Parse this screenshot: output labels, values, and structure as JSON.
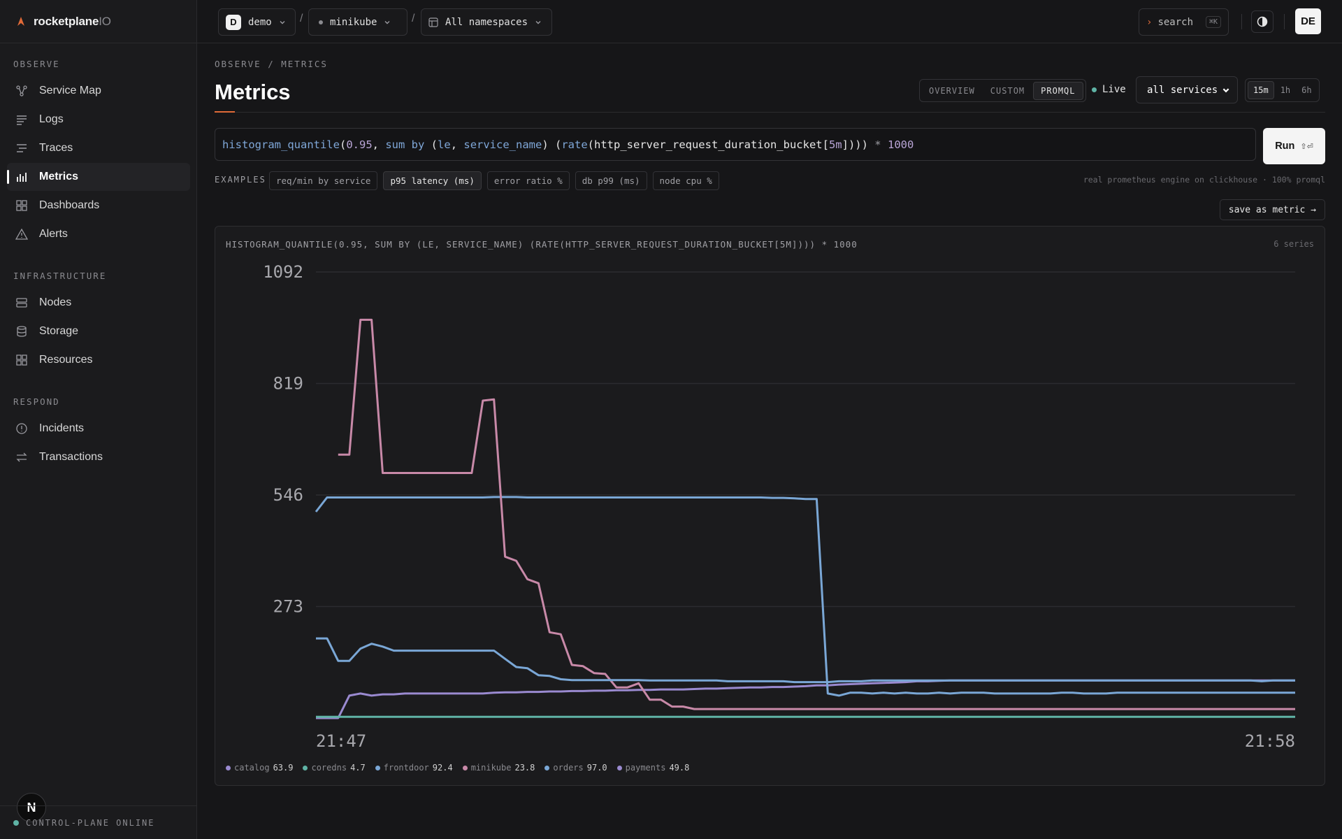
{
  "app": {
    "brand_name": "rocketplane",
    "brand_suffix": "IO",
    "footer_status": "CONTROL-PLANE ONLINE",
    "n_badge": "N"
  },
  "sidebar": {
    "sections": [
      {
        "title": "OBSERVE",
        "items": [
          {
            "label": "Service Map",
            "icon": "service-map-icon"
          },
          {
            "label": "Logs",
            "icon": "logs-icon"
          },
          {
            "label": "Traces",
            "icon": "traces-icon"
          },
          {
            "label": "Metrics",
            "icon": "metrics-icon",
            "active": true
          },
          {
            "label": "Dashboards",
            "icon": "dashboards-icon"
          },
          {
            "label": "Alerts",
            "icon": "alert-triangle-icon"
          }
        ]
      },
      {
        "title": "INFRASTRUCTURE",
        "items": [
          {
            "label": "Nodes",
            "icon": "server-icon"
          },
          {
            "label": "Storage",
            "icon": "database-icon"
          },
          {
            "label": "Resources",
            "icon": "grid-icon"
          }
        ]
      },
      {
        "title": "RESPOND",
        "items": [
          {
            "label": "Incidents",
            "icon": "shield-icon"
          },
          {
            "label": "Transactions",
            "icon": "swap-icon"
          }
        ]
      }
    ]
  },
  "topbar": {
    "org_badge": "D",
    "org": "demo",
    "cluster": "minikube",
    "namespace": "All namespaces",
    "search_label": "search",
    "search_shortcut": "⌘K",
    "avatar": "DE",
    "separator": "/"
  },
  "main": {
    "breadcrumb": "OBSERVE / METRICS",
    "title": "Metrics",
    "mode_tabs": [
      "OVERVIEW",
      "CUSTOM",
      "PROMQL"
    ],
    "active_mode": "PROMQL",
    "live_label": "Live",
    "service_select": "all services",
    "range_tabs": [
      "15m",
      "1h",
      "6h"
    ],
    "active_range": "15m",
    "query": "histogram_quantile(0.95, sum by (le, service_name) (rate(http_server_request_duration_bucket[5m]))) * 1000",
    "run_label": "Run",
    "run_shortcut": "⇧⏎",
    "examples_label": "EXAMPLES",
    "examples": [
      "req/min by service",
      "p95 latency (ms)",
      "error ratio %",
      "db p99 (ms)",
      "node cpu %"
    ],
    "active_example": "p95 latency (ms)",
    "engine_note": "real prometheus engine on clickhouse · 100% promql",
    "save_metric": "save as metric →",
    "panel_title": "HISTOGRAM_QUANTILE(0.95, SUM BY (LE, SERVICE_NAME) (RATE(HTTP_SERVER_REQUEST_DURATION_BUCKET[5M]))) * 1000",
    "series_count": "6 series"
  },
  "chart_data": {
    "type": "line",
    "y_ticks": [
      "1092",
      "819",
      "546",
      "273"
    ],
    "ylim": [
      0,
      1092
    ],
    "x_labels": [
      "21:47",
      "21:58"
    ],
    "grid": true,
    "legend_position": "bottom",
    "series": [
      {
        "name": "catalog",
        "legend_value": "63.9",
        "color": "#9a8ad0",
        "values": [
          0,
          0,
          0,
          55,
          60,
          55,
          58,
          58,
          60,
          60,
          60,
          60,
          60,
          60,
          60,
          60,
          62,
          63,
          63,
          64,
          64,
          65,
          65,
          66,
          66,
          67,
          67,
          68,
          68,
          69,
          69,
          70,
          70,
          70,
          71,
          72,
          72,
          73,
          74,
          75,
          75,
          76,
          76,
          77,
          78,
          80,
          80,
          82,
          83,
          84,
          85,
          86,
          87,
          88,
          90,
          90,
          91,
          92,
          92,
          92,
          92,
          92,
          92,
          92,
          92,
          92,
          92,
          92,
          92,
          92,
          92,
          92,
          92,
          92,
          92,
          92,
          92,
          92,
          92,
          92,
          92,
          92,
          92,
          92,
          92,
          92,
          92,
          92,
          92
        ]
      },
      {
        "name": "coredns",
        "legend_value": "4.7",
        "color": "#5fb3a5",
        "values": [
          3,
          3,
          3,
          3,
          3,
          3,
          3,
          3,
          3,
          3,
          3,
          3,
          3,
          3,
          3,
          3,
          3,
          3,
          3,
          3,
          3,
          3,
          3,
          3,
          3,
          3,
          3,
          3,
          3,
          3,
          3,
          3,
          3,
          3,
          3,
          3,
          3,
          3,
          3,
          3,
          3,
          3,
          3,
          3,
          3,
          3,
          3,
          3,
          3,
          3,
          3,
          3,
          3,
          3,
          3,
          3,
          3,
          3,
          3,
          3,
          3,
          3,
          3,
          3,
          3,
          3,
          3,
          3,
          3,
          3,
          3,
          3,
          3,
          3,
          3,
          3,
          3,
          3,
          3,
          3,
          3,
          3,
          3,
          3,
          3,
          3,
          3,
          3,
          3
        ]
      },
      {
        "name": "frontdoor",
        "legend_value": "92.4",
        "color": "#7aa7d6",
        "values": [
          505,
          540,
          540,
          540,
          540,
          540,
          540,
          540,
          540,
          540,
          540,
          540,
          540,
          540,
          540,
          540,
          541,
          541,
          541,
          540,
          540,
          540,
          540,
          540,
          540,
          540,
          540,
          540,
          540,
          540,
          540,
          540,
          540,
          540,
          540,
          540,
          540,
          540,
          540,
          540,
          540,
          539,
          539,
          538,
          536,
          536,
          60,
          55,
          62,
          62,
          60,
          62,
          60,
          62,
          60,
          60,
          62,
          60,
          62,
          62,
          62,
          60,
          60,
          60,
          60,
          60,
          60,
          62,
          62,
          60,
          60,
          60,
          62,
          62,
          62,
          62,
          62,
          62,
          62,
          62,
          62,
          62,
          62,
          62,
          62,
          62,
          62,
          62,
          62
        ]
      },
      {
        "name": "minikube",
        "legend_value": "23.8",
        "color": "#c889a8",
        "values": [
          null,
          null,
          645,
          645,
          975,
          975,
          600,
          600,
          600,
          600,
          600,
          600,
          600,
          600,
          600,
          777,
          780,
          395,
          385,
          340,
          330,
          210,
          205,
          130,
          127,
          110,
          108,
          75,
          75,
          85,
          45,
          45,
          28,
          28,
          22,
          22,
          22,
          22,
          22,
          22,
          22,
          22,
          22,
          22,
          22,
          22,
          22,
          22,
          22,
          22,
          22,
          22,
          22,
          22,
          22,
          22,
          22,
          22,
          22,
          22,
          22,
          22,
          22,
          22,
          22,
          22,
          22,
          22,
          22,
          22,
          22,
          22,
          22,
          22,
          22,
          22,
          22,
          22,
          22,
          22,
          22,
          22,
          22,
          22,
          22,
          22,
          22,
          22,
          22
        ]
      },
      {
        "name": "orders",
        "legend_value": "97.0",
        "color": "#7aa7d6",
        "values": [
          195,
          195,
          140,
          140,
          170,
          182,
          175,
          165,
          165,
          165,
          165,
          165,
          165,
          165,
          165,
          165,
          165,
          145,
          125,
          122,
          105,
          103,
          95,
          93,
          93,
          93,
          93,
          93,
          93,
          93,
          92,
          92,
          92,
          92,
          92,
          92,
          92,
          90,
          90,
          90,
          90,
          90,
          90,
          88,
          88,
          88,
          88,
          90,
          90,
          90,
          92,
          92,
          92,
          92,
          92,
          92,
          92,
          92,
          92,
          92,
          92,
          92,
          92,
          92,
          92,
          92,
          92,
          92,
          92,
          92,
          92,
          92,
          92,
          92,
          92,
          92,
          92,
          92,
          92,
          92,
          92,
          92,
          92,
          92,
          92,
          90,
          92,
          92,
          92
        ]
      },
      {
        "name": "payments",
        "legend_value": "49.8",
        "color": "#9a8ad0",
        "values": [
          null,
          null,
          null,
          null,
          null,
          null,
          null,
          null,
          null,
          null,
          null,
          null,
          null,
          null,
          null,
          null,
          null,
          null,
          null,
          null,
          null,
          null,
          null,
          null,
          null,
          null,
          null,
          null,
          null,
          null,
          null,
          null,
          null,
          null,
          null,
          null,
          null,
          null,
          null,
          null,
          null,
          null,
          null,
          null,
          null,
          null,
          null,
          null,
          null,
          null,
          null,
          null,
          null,
          null,
          null,
          null,
          null,
          null,
          null,
          null,
          null,
          null,
          null,
          null,
          null,
          null,
          null,
          null,
          null,
          null,
          null,
          null,
          null,
          null,
          null,
          null,
          null,
          null,
          null,
          null,
          null,
          null,
          null,
          null,
          null,
          null,
          null,
          null,
          null
        ]
      }
    ]
  }
}
